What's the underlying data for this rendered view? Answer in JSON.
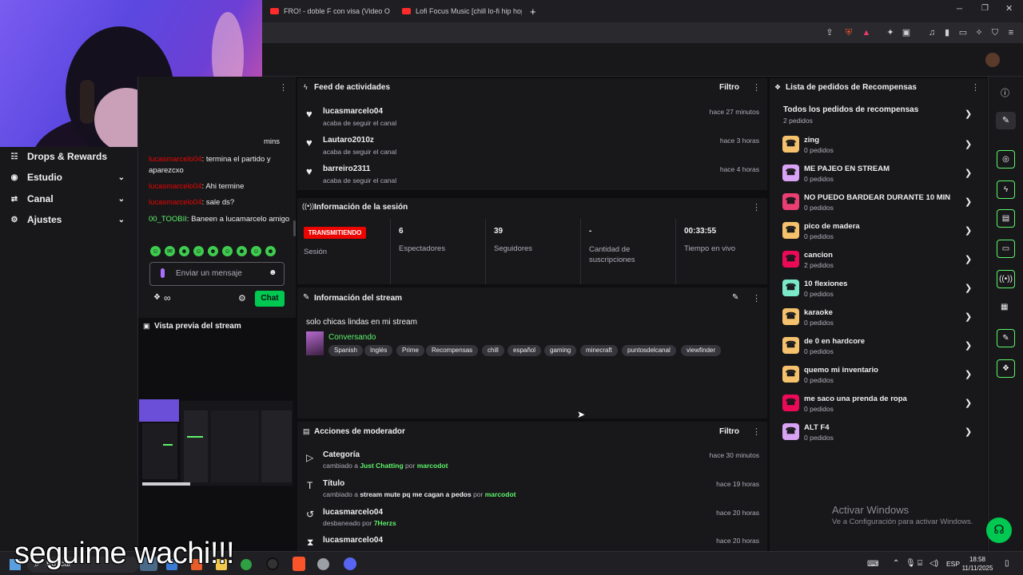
{
  "browser": {
    "tabs": [
      {
        "label": "FRO! - doble F con visa (Video Oficia"
      },
      {
        "label": "Lofi Focus Music [chill lo-fi hip hop b"
      }
    ],
    "new_tab": "+"
  },
  "sidebar": {
    "items": [
      {
        "label": "Drops & Rewards"
      },
      {
        "label": "Estudio"
      },
      {
        "label": "Canal"
      },
      {
        "label": "Ajustes"
      }
    ]
  },
  "chat": {
    "partial": "mins",
    "messages": [
      {
        "user": "lucasmarcelo04",
        "text": "termina el partido y aparezcxo"
      },
      {
        "user": "lucasmarcelo04",
        "text": "Ahi termine"
      },
      {
        "user": "lucasmarcelo04",
        "text": "sale ds?"
      },
      {
        "user": "00_TOOBII",
        "text": "Baneen a lucamarcelo amigo"
      }
    ],
    "input_placeholder": "Enviar un mensaje",
    "points": "∞",
    "send_label": "Chat"
  },
  "preview": {
    "title": "Vista previa del stream"
  },
  "activity_feed": {
    "title": "Feed de actividades",
    "filter": "Filtro",
    "items": [
      {
        "user": "lucasmarcelo04",
        "action": "acaba de seguir el canal",
        "time": "hace 27 minutos"
      },
      {
        "user": "Lautaro2010z",
        "action": "acaba de seguir el canal",
        "time": "hace 3 horas"
      },
      {
        "user": "barreiro2311",
        "action": "acaba de seguir el canal",
        "time": "hace 4 horas"
      }
    ]
  },
  "session": {
    "title": "Información de la sesión",
    "live_badge": "TRANSMITIENDO",
    "live_label": "Sesión",
    "stats": [
      {
        "value": "6",
        "label": "Espectadores"
      },
      {
        "value": "39",
        "label": "Seguidores"
      },
      {
        "value": "-",
        "label": "Cantidad de suscripciones"
      },
      {
        "value": "00:33:55",
        "label": "Tiempo en vivo"
      }
    ]
  },
  "stream_info": {
    "title": "Información del stream",
    "stream_title": "solo chicas lindas en mi stream",
    "category": "Conversando",
    "tags": [
      "Spanish",
      "Inglés",
      "Prime",
      "Recompensas",
      "chill",
      "español",
      "gaming",
      "minecraft",
      "puntosdelcanal",
      "viewfinder"
    ]
  },
  "mod_actions": {
    "title": "Acciones de moderador",
    "filter": "Filtro",
    "items": [
      {
        "title": "Categoría",
        "pre": "cambiado a",
        "target": "Just Chatting",
        "mid": "por",
        "by": "marcodot",
        "time": "hace 30 minutos"
      },
      {
        "title": "Título",
        "pre": "cambiado a",
        "target": "stream mute pq me cagan a pedos",
        "mid": "por",
        "by": "marcodot",
        "time": "hace 19 horas"
      },
      {
        "title": "lucasmarcelo04",
        "pre": "desbaneado por",
        "target": "",
        "mid": "",
        "by": "7Herzs",
        "time": "hace 20 horas"
      },
      {
        "title": "lucasmarcelo04",
        "pre": "",
        "target": "",
        "mid": "",
        "by": "",
        "time": "hace 20 horas"
      }
    ]
  },
  "rewards": {
    "title": "Lista de pedidos de Recompensas",
    "all_title": "Todos los pedidos de recompensas",
    "all_sub": "2 pedidos",
    "items": [
      {
        "name": "zing",
        "count": "0 pedidos",
        "color": "#f5c16c"
      },
      {
        "name": "ME PAJEO EN STREAM",
        "count": "0 pedidos",
        "color": "#d9a3f5"
      },
      {
        "name": "NO PUEDO BARDEAR DURANTE 10 MIN",
        "count": "0 pedidos",
        "color": "#eb3e72"
      },
      {
        "name": "pico de madera",
        "count": "0 pedidos",
        "color": "#f5c16c"
      },
      {
        "name": "cancion",
        "count": "2 pedidos",
        "color": "#eb0a55"
      },
      {
        "name": "10 flexiones",
        "count": "0 pedidos",
        "color": "#7be8c8"
      },
      {
        "name": "karaoke",
        "count": "0 pedidos",
        "color": "#f5c16c"
      },
      {
        "name": "de 0 en hardcore",
        "count": "0 pedidos",
        "color": "#f5c16c"
      },
      {
        "name": "quemo mi inventario",
        "count": "0 pedidos",
        "color": "#f5c16c"
      },
      {
        "name": "me saco una prenda de ropa",
        "count": "0 pedidos",
        "color": "#eb0a55"
      },
      {
        "name": "ALT F4",
        "count": "0 pedidos",
        "color": "#d9a3f5"
      }
    ]
  },
  "windows": {
    "activate_title": "Activar Windows",
    "activate_sub": "Ve a Configuración para activar Windows.",
    "search": "Buscar",
    "lang": "ESP",
    "time": "18:58",
    "date": "11/11/2025"
  },
  "overlay": {
    "text": "seguime wachi!!!"
  },
  "colors": {
    "accent_green": "#5ef46a",
    "live_red": "#eb0400",
    "brand": "#00c851"
  }
}
